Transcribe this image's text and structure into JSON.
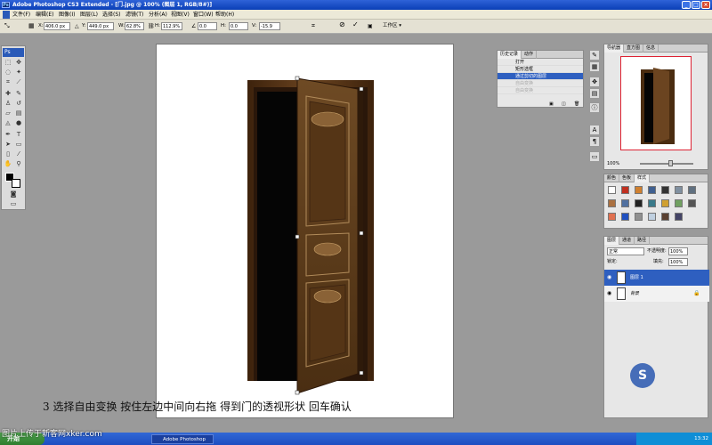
{
  "window": {
    "title": "Adobe Photoshop CS3 Extended - [门.jpg @ 100% (图层 1, RGB/8#)]"
  },
  "menu": [
    "文件(F)",
    "编辑(E)",
    "图像(I)",
    "图层(L)",
    "选择(S)",
    "滤镜(T)",
    "分析(A)",
    "视图(V)",
    "窗口(W)",
    "帮助(H)"
  ],
  "options": {
    "x_label": "X:",
    "x_value": "406.0 px",
    "y_label": "Y:",
    "y_value": "449.0 px",
    "w_label": "W:",
    "w_value": "62.8%",
    "h_label": "H:",
    "h_value": "112.9%",
    "angle_value": "0.0",
    "hskew_label": "H:",
    "hskew_value": "0.0",
    "vskew_label": "V:",
    "vskew_value": "-15.9",
    "workspace_label": "工作区 ▾"
  },
  "tools": {
    "ps_label": "Ps"
  },
  "history_panel": {
    "tabs": [
      "历史记录",
      "动作"
    ],
    "items": [
      {
        "label": "打开",
        "state": "normal"
      },
      {
        "label": "矩形选框",
        "state": "normal"
      },
      {
        "label": "通过剪切的图层",
        "state": "selected"
      },
      {
        "label": "自由变换",
        "state": "dim"
      },
      {
        "label": "自由变换",
        "state": "dim"
      }
    ]
  },
  "navigator_panel": {
    "tabs": [
      "导航器",
      "直方图",
      "信息"
    ]
  },
  "styles_panel": {
    "tabs": [
      "颜色",
      "色板",
      "样式"
    ]
  },
  "layers_panel": {
    "tabs": [
      "图层",
      "通道",
      "路径"
    ],
    "blend_mode": "正常",
    "opacity_label": "不透明度:",
    "opacity_value": "100%",
    "lock_label": "锁定:",
    "fill_label": "填充:",
    "fill_value": "100%",
    "layers": [
      {
        "name": "图层 1",
        "selected": true
      },
      {
        "name": "背景",
        "selected": false
      }
    ]
  },
  "status": {
    "zoom": "100%"
  },
  "caption": "3 选择自由变换 按住左边中间向右拖 得到门的透视形状 回车确认",
  "taskbar": {
    "start_label": "开始",
    "task_label": "Adobe Photoshop",
    "clock": "13:32"
  },
  "watermarks": {
    "bottom_left": "图片上传于新客网xker.com"
  },
  "colors": {
    "title_bar": "#0a3fb6",
    "selection": "#2e5fc0",
    "door_wood": "#5a3818"
  }
}
